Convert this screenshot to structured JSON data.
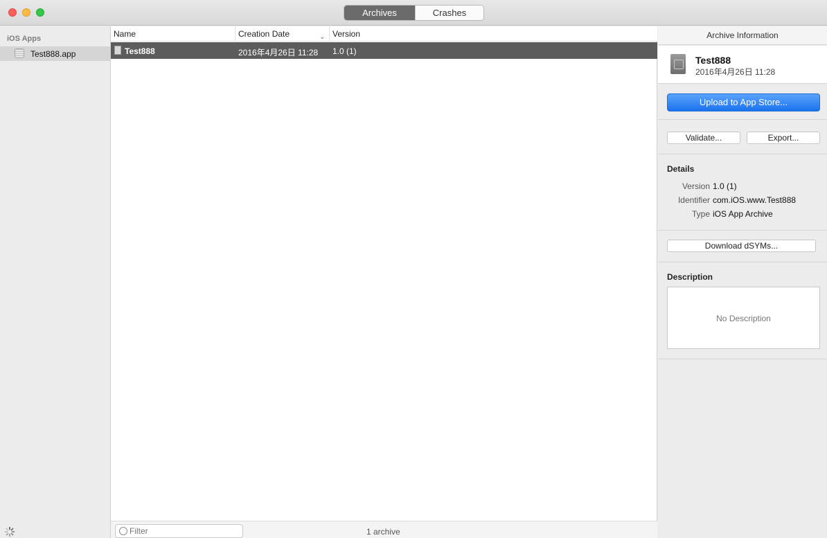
{
  "toolbar": {
    "tabs": [
      "Archives",
      "Crashes"
    ],
    "active_tab": "Archives"
  },
  "sidebar": {
    "heading": "iOS Apps",
    "items": [
      {
        "label": "Test888.app",
        "selected": true
      }
    ]
  },
  "table": {
    "columns": [
      "Name",
      "Creation Date",
      "Version"
    ],
    "sorted_column": "Creation Date",
    "rows": [
      {
        "name": "Test888",
        "date": "2016年4月26日 11:28",
        "version": "1.0 (1)",
        "selected": true
      }
    ]
  },
  "footer": {
    "filter_placeholder": "Filter",
    "count_label": "1 archive"
  },
  "inspector": {
    "title": "Archive Information",
    "archive_name": "Test888",
    "archive_date": "2016年4月26日 11:28",
    "upload_label": "Upload to App Store...",
    "validate_label": "Validate...",
    "export_label": "Export...",
    "details_title": "Details",
    "details": [
      {
        "label": "Version",
        "value": "1.0 (1)"
      },
      {
        "label": "Identifier",
        "value": "com.iOS.www.Test888"
      },
      {
        "label": "Type",
        "value": "iOS App Archive"
      }
    ],
    "dsym_label": "Download dSYMs...",
    "description_title": "Description",
    "description_text": "No Description"
  },
  "colors": {
    "accent": "#1b72ee",
    "selection": "#5c5c5c",
    "traffic_red": "#fc605c",
    "traffic_yellow": "#fdbc40",
    "traffic_green": "#34c84a"
  }
}
